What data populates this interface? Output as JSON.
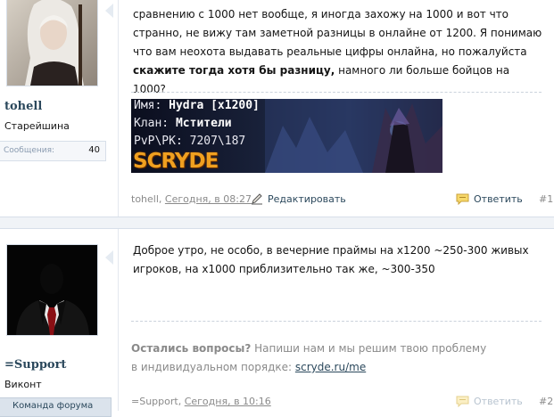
{
  "posts": [
    {
      "user": {
        "name": "tohell",
        "rank": "Старейшина",
        "messages_label": "Сообщения:",
        "messages_count": "40"
      },
      "message": {
        "part1": "сравнению с 1000 нет вообще, я иногда захожу на 1000 и вот что странно, не вижу там заметной разницы в онлайне от 1200. Я понимаю что вам неохота выдавать реальные цифры онлайна, но пожалуйста ",
        "bold": "скажите тогда хотя бы разницу,",
        "part2": " намного ли больше бойцов на 1000?"
      },
      "signature_banner": {
        "line1_label": "Имя: ",
        "line1_value": "Hydra [x1200]",
        "line2_label": "Клан: ",
        "line2_value": "Мстители",
        "line3_label": "PvP\\PK: ",
        "line3_value": "7207\\187",
        "logo": "SCRYDE"
      },
      "footer": {
        "author": "tohell",
        "sep": ", ",
        "date": "Сегодня, в 08:27",
        "edit_label": "Редактировать",
        "reply_label": "Ответить",
        "number": "#1"
      }
    },
    {
      "user": {
        "name": "=Support",
        "rank": "Виконт",
        "staff_label": "Команда форума"
      },
      "message": {
        "text": "Доброе утро, не особо, в вечерние праймы на х1200 ~250-300 живых игроков, на х1000 приблизительно так же, ~300-350"
      },
      "signature": {
        "bold": "Остались вопросы?",
        "text": " Напиши нам и мы решим твою проблему в индивидуальном порядке: ",
        "link": "scryde.ru/me"
      },
      "footer": {
        "author": "=Support",
        "sep": ", ",
        "date": "Сегодня, в 10:16",
        "reply_label": "Ответить",
        "number": "#2"
      }
    }
  ],
  "colors": {
    "username": "#2b485c",
    "link": "#2b485c",
    "muted": "#8a8a8a",
    "border": "#d7dfe9",
    "banner_logo": "#f0a020"
  },
  "icons": {
    "edit": "pencil-icon",
    "reply": "speech-bubble-icon"
  }
}
